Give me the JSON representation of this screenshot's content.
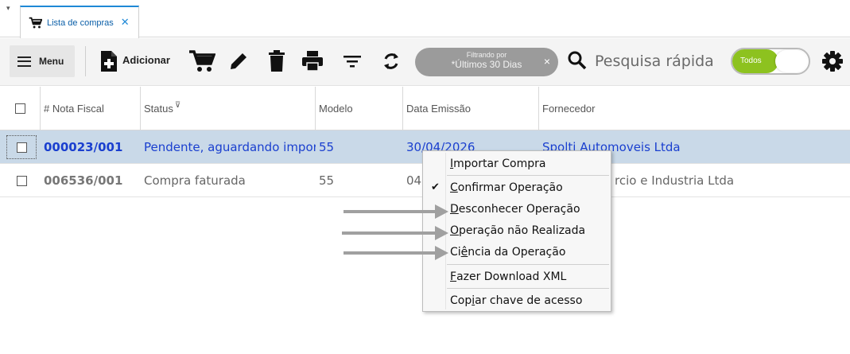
{
  "tab": {
    "label": "Lista de compras",
    "close": "✕"
  },
  "toolbar": {
    "menu_label": "Menu",
    "add_label": "Adicionar",
    "filter": {
      "caption": "Filtrando por",
      "value": "*Últimos 30 Dias",
      "close": "×"
    },
    "search_placeholder": "Pesquisa rápida",
    "toggle_label": "Todos",
    "colors": {
      "toggle_on": "#8dc21f",
      "tab_accent": "#1e88d6"
    }
  },
  "grid": {
    "columns": [
      "# Nota Fiscal",
      "Status",
      "Modelo",
      "Data Emissão",
      "Fornecedor"
    ],
    "status_filter_glyph": "⊽",
    "rows": [
      {
        "nota": "000023/001",
        "status": "Pendente, aguardando importação",
        "modelo": "55",
        "data": "30/04/2026",
        "fornecedor": "Spolti Automoveis Ltda"
      },
      {
        "nota": "006536/001",
        "status": "Compra faturada",
        "modelo": "55",
        "data": "04",
        "fornecedor": "rcio e Industria Ltda"
      }
    ]
  },
  "context_menu": {
    "items": [
      {
        "before": "",
        "key": "I",
        "after": "mportar Compra"
      },
      {
        "before": "",
        "key": "C",
        "after": "onfirmar Operação",
        "check": "✔"
      },
      {
        "before": "",
        "key": "D",
        "after": "esconhecer Operação"
      },
      {
        "before": "",
        "key": "O",
        "after": "peração não Realizada"
      },
      {
        "before": "Ci",
        "key": "ê",
        "after": "ncia da Operação"
      },
      {
        "before": "",
        "key": "F",
        "after": "azer Download XML"
      },
      {
        "before": "Cop",
        "key": "i",
        "after": "ar chave de acesso"
      }
    ]
  }
}
